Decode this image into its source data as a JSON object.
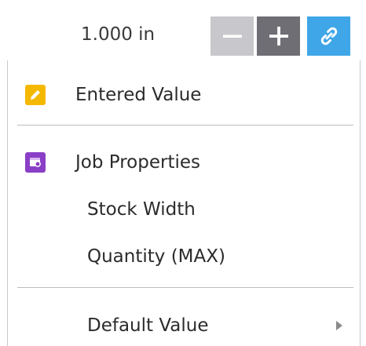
{
  "field": {
    "value": "1.000 in"
  },
  "buttons": {
    "decrement": "minus-icon",
    "increment": "plus-icon",
    "link": "link-icon"
  },
  "menu": {
    "entered_value": "Entered Value",
    "job_properties": "Job Properties",
    "stock_width": "Stock Width",
    "quantity_max": "Quantity (MAX)",
    "default_value": "Default Value"
  },
  "colors": {
    "minus_button": "#c8c8cc",
    "plus_button": "#6e6e74",
    "link_button": "#3fa6e8",
    "pencil_icon": "#f5b800",
    "job_icon": "#8a3fc7"
  }
}
